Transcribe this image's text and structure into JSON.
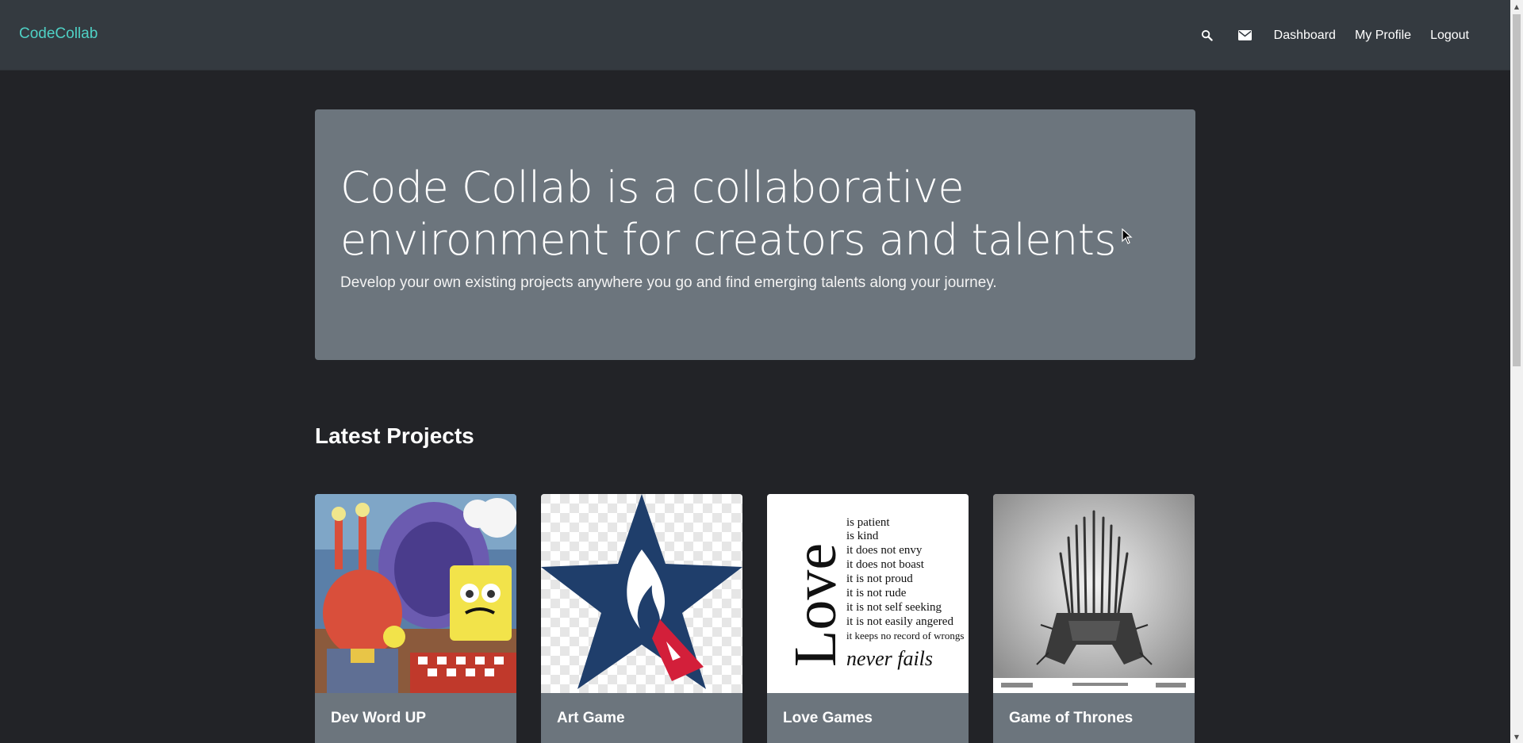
{
  "navbar": {
    "brand": "CodeCollab",
    "icons": [
      "search-icon",
      "envelope-icon"
    ],
    "links": [
      "Dashboard",
      "My Profile",
      "Logout"
    ]
  },
  "hero": {
    "title": "Code Collab is a collaborative environment for creators and talents",
    "subtitle": "Develop your own existing projects anywhere you go and find emerging talents along your journey."
  },
  "latest": {
    "heading": "Latest Projects",
    "projects": [
      {
        "title": "Dev Word UP",
        "image": "cartoon-chefs-image"
      },
      {
        "title": "Art Game",
        "image": "star-logo-image"
      },
      {
        "title": "Love Games",
        "image": "love-poem-image",
        "poem_word": "Love",
        "poem_lines": [
          "is patient",
          "is kind",
          "it does not envy",
          "it does not boast",
          "it is not proud",
          "it is not rude",
          "it is not self seeking",
          "it is not easily angered",
          "it keeps no record of wrongs"
        ],
        "poem_end": "never fails"
      },
      {
        "title": "Game of Thrones",
        "image": "iron-throne-image"
      }
    ]
  },
  "colors": {
    "brand": "#4fd1c5",
    "navbar_bg": "#343a40",
    "page_bg": "#222327",
    "hero_bg": "#6c757d"
  }
}
